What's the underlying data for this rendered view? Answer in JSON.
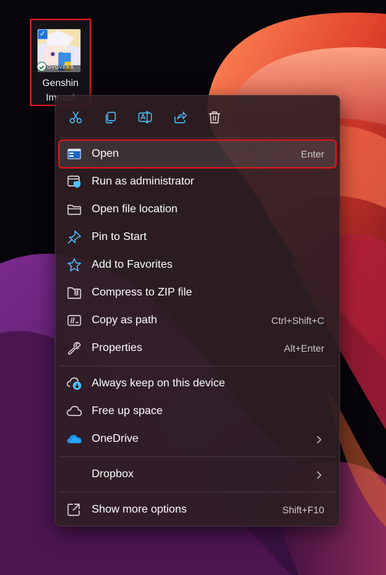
{
  "desktop_icon": {
    "label": "Genshin Impact",
    "icon": "genshin-impact-app-icon",
    "overlay_text": "OVOVERS"
  },
  "quick_actions": [
    {
      "name": "cut-button",
      "icon": "scissors-icon"
    },
    {
      "name": "copy-button",
      "icon": "copy-icon"
    },
    {
      "name": "rename-button",
      "icon": "rename-icon"
    },
    {
      "name": "share-button",
      "icon": "share-icon"
    },
    {
      "name": "delete-button",
      "icon": "trash-icon"
    }
  ],
  "menu": {
    "items": [
      {
        "label": "Open",
        "shortcut": "Enter",
        "icon": "app-window-icon"
      },
      {
        "label": "Run as administrator",
        "icon": "shield-window-icon"
      },
      {
        "label": "Open file location",
        "icon": "folder-icon"
      },
      {
        "label": "Pin to Start",
        "icon": "pin-icon"
      },
      {
        "label": "Add to Favorites",
        "icon": "star-icon"
      },
      {
        "label": "Compress to ZIP file",
        "icon": "zip-folder-icon"
      },
      {
        "label": "Copy as path",
        "shortcut": "Ctrl+Shift+C",
        "icon": "copy-path-icon"
      },
      {
        "label": "Properties",
        "shortcut": "Alt+Enter",
        "icon": "wrench-icon"
      },
      {
        "label": "Always keep on this device",
        "icon": "cloud-download-icon"
      },
      {
        "label": "Free up space",
        "icon": "cloud-outline-icon"
      },
      {
        "label": "OneDrive",
        "icon": "onedrive-icon",
        "submenu": true
      },
      {
        "label": "Dropbox",
        "submenu": true
      },
      {
        "label": "Show more options",
        "shortcut": "Shift+F10",
        "icon": "external-link-icon"
      }
    ]
  },
  "colors": {
    "highlight_border": "#e01818",
    "accent": "#4cc2ff",
    "menu_background": "#2e1e24"
  }
}
